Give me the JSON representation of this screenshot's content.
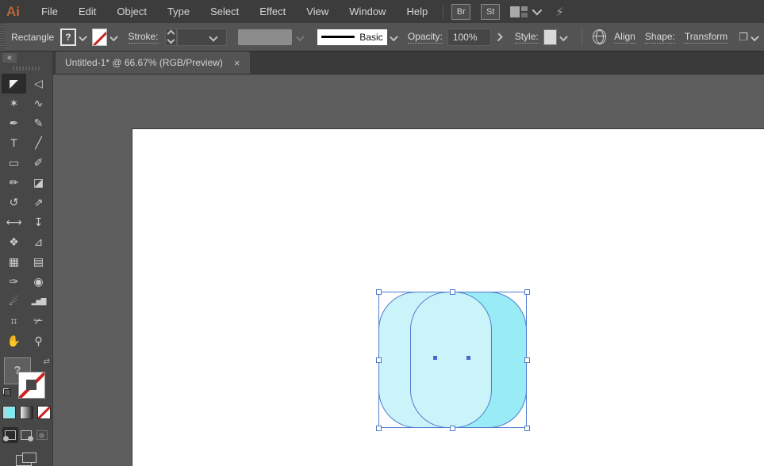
{
  "menubar": {
    "logo": "Ai",
    "items": [
      "File",
      "Edit",
      "Object",
      "Type",
      "Select",
      "Effect",
      "View",
      "Window",
      "Help"
    ],
    "brushes_button": "Br",
    "styles_button": "St"
  },
  "control_bar": {
    "context_label": "Rectangle",
    "fill_unknown": "?",
    "stroke_label": "Stroke:",
    "brush_name": "Basic",
    "opacity_label": "Opacity:",
    "opacity_value": "100%",
    "style_label": "Style:",
    "align_label": "Align",
    "shape_label": "Shape:",
    "transform_label": "Transform"
  },
  "tabbar": {
    "collapse_glyph": "«",
    "doc_title": "Untitled-1* @ 66.67% (RGB/Preview)",
    "close_glyph": "×"
  },
  "tools": [
    {
      "name": "selection-tool",
      "glyph": "◤",
      "active": true
    },
    {
      "name": "direct-selection-tool",
      "glyph": "◁"
    },
    {
      "name": "magic-wand-tool",
      "glyph": "✶"
    },
    {
      "name": "lasso-tool",
      "glyph": "∿"
    },
    {
      "name": "pen-tool",
      "glyph": "✒"
    },
    {
      "name": "curvature-tool",
      "glyph": "✎"
    },
    {
      "name": "type-tool",
      "glyph": "T"
    },
    {
      "name": "line-segment-tool",
      "glyph": "╱"
    },
    {
      "name": "rectangle-tool",
      "glyph": "▭"
    },
    {
      "name": "paintbrush-tool",
      "glyph": "✐"
    },
    {
      "name": "pencil-tool",
      "glyph": "✏"
    },
    {
      "name": "eraser-tool",
      "glyph": "◪"
    },
    {
      "name": "rotate-tool",
      "glyph": "↺"
    },
    {
      "name": "scale-tool",
      "glyph": "⇗"
    },
    {
      "name": "width-tool",
      "glyph": "⟷"
    },
    {
      "name": "puppet-warp-tool",
      "glyph": "↧"
    },
    {
      "name": "shape-builder-tool",
      "glyph": "❖"
    },
    {
      "name": "perspective-grid-tool",
      "glyph": "⊿"
    },
    {
      "name": "mesh-tool",
      "glyph": "▦"
    },
    {
      "name": "gradient-tool",
      "glyph": "▤"
    },
    {
      "name": "eyedropper-tool",
      "glyph": "✑"
    },
    {
      "name": "blend-tool",
      "glyph": "◉"
    },
    {
      "name": "symbol-sprayer-tool",
      "glyph": "☄"
    },
    {
      "name": "column-graph-tool",
      "glyph": "▂▅▇",
      "small": true
    },
    {
      "name": "artboard-tool",
      "glyph": "⌗"
    },
    {
      "name": "slice-tool",
      "glyph": "✃"
    },
    {
      "name": "hand-tool",
      "glyph": "✋"
    },
    {
      "name": "zoom-tool",
      "glyph": "⚲"
    }
  ],
  "toolbox_bottom": {
    "fill_unknown": "?",
    "swap_glyph": "⇄"
  },
  "artwork": {
    "selection_color": "#4f7ccf",
    "shapes": [
      {
        "type": "rounded-rect",
        "fill": "#99ebf6",
        "z": "back"
      },
      {
        "type": "rounded-rect",
        "fill": "#cbf4fa",
        "z": "front"
      }
    ],
    "artboard_color": "#ffffff",
    "pasteboard_color": "#5d5d5d"
  },
  "colors": {
    "menubar_bg": "#3c3c3c",
    "controlbar_bg": "#535353",
    "dock_bg": "#474747",
    "active_tool_bg": "#2b2b2b",
    "logo_orange": "#b5683e",
    "swatch_cyan": "#7de9f2",
    "stroke_none_red": "#cc2222"
  }
}
